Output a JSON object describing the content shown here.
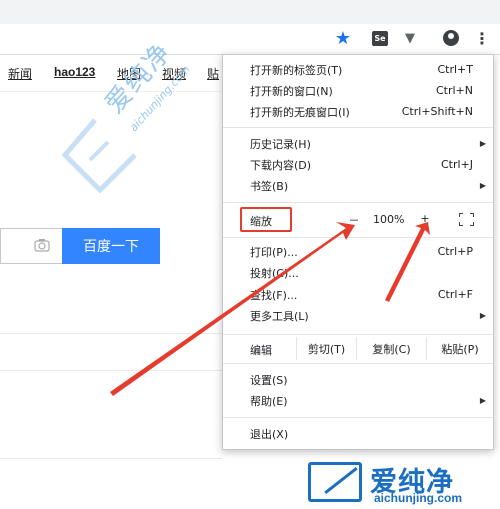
{
  "nav_links": [
    "新闻",
    "hao123",
    "地图",
    "视频",
    "贴"
  ],
  "watermark": {
    "cn": "爱纯净",
    "url": "aichunjing.com"
  },
  "search": {
    "button_label": "百度一下"
  },
  "logo": {
    "cn": "爱纯净",
    "url": "aichunjing.com"
  },
  "menu": {
    "group1": [
      {
        "label": "打开新的标签页(T)",
        "shortcut": "Ctrl+T"
      },
      {
        "label": "打开新的窗口(N)",
        "shortcut": "Ctrl+N"
      },
      {
        "label": "打开新的无痕窗口(I)",
        "shortcut": "Ctrl+Shift+N"
      }
    ],
    "group2": [
      {
        "label": "历史记录(H)",
        "shortcut": ""
      },
      {
        "label": "下载内容(D)",
        "shortcut": "Ctrl+J"
      },
      {
        "label": "书签(B)",
        "shortcut": ""
      }
    ],
    "zoom": {
      "label": "缩放",
      "minus": "－",
      "value": "100%",
      "plus": "+"
    },
    "group3": [
      {
        "label": "打印(P)...",
        "shortcut": "Ctrl+P"
      },
      {
        "label": "投射(C)...",
        "shortcut": ""
      },
      {
        "label": "查找(F)...",
        "shortcut": "Ctrl+F"
      },
      {
        "label": "更多工具(L)",
        "shortcut": ""
      }
    ],
    "edit": {
      "label": "编辑",
      "cut": "剪切(T)",
      "copy": "复制(C)",
      "paste": "粘贴(P)"
    },
    "group4": [
      {
        "label": "设置(S)"
      },
      {
        "label": "帮助(E)"
      }
    ],
    "exit": {
      "label": "退出(X)"
    }
  },
  "colors": {
    "accent": "#1a73e8",
    "search_button": "#3385ff",
    "highlight": "#e53c2d",
    "logo": "#1a6fc2"
  }
}
